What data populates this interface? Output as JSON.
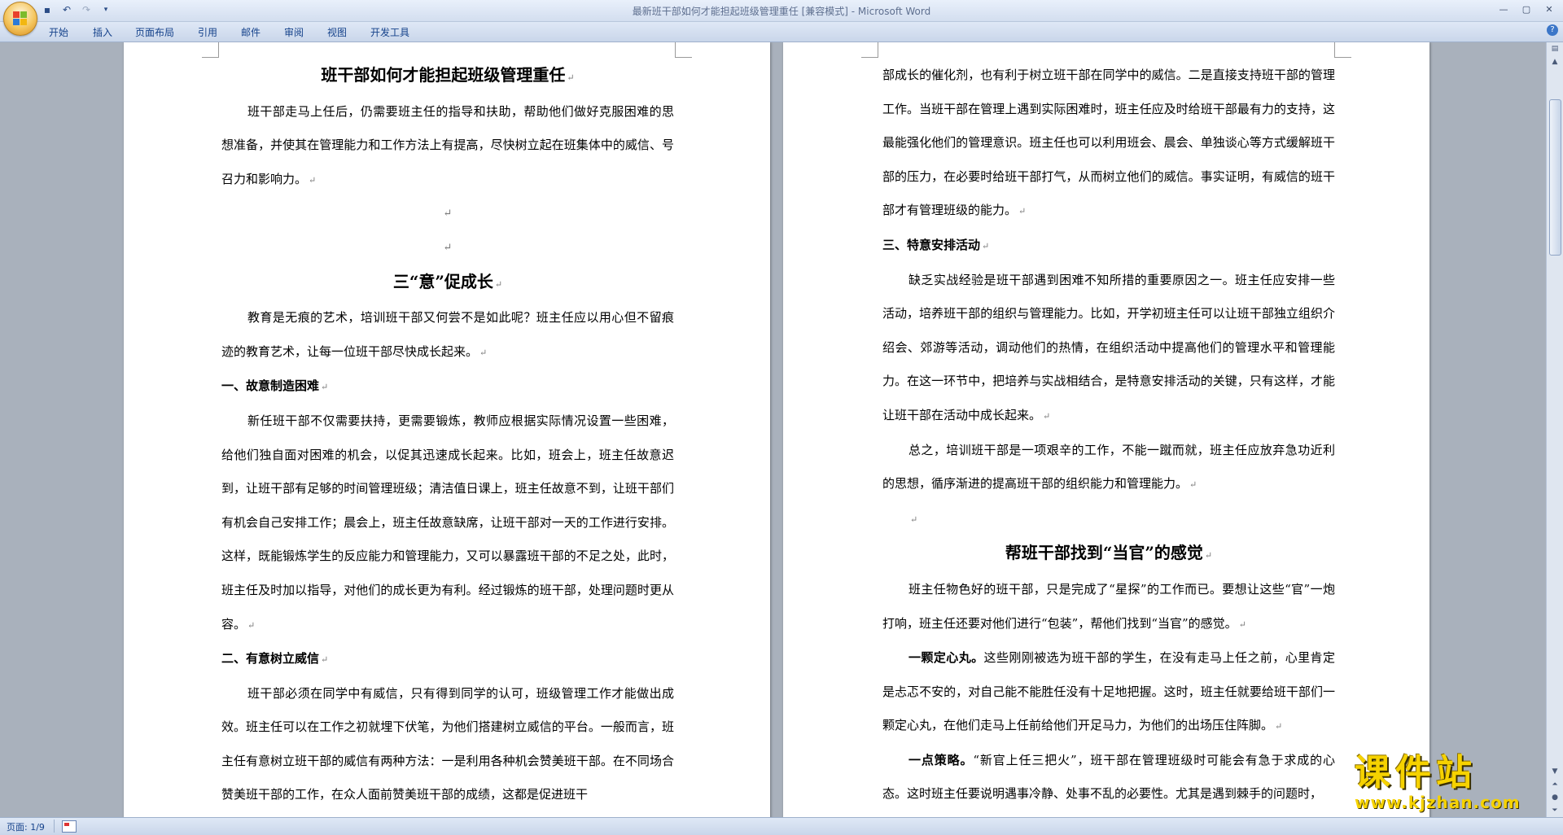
{
  "window": {
    "title": "最新班干部如何才能担起班级管理重任 [兼容模式] - Microsoft Word",
    "controls": [
      "minimize",
      "maximize",
      "close"
    ]
  },
  "quick_access": {
    "icons": [
      "save-icon",
      "undo-icon",
      "redo-icon",
      "customize-icon"
    ],
    "save_glyph": "▪",
    "undo_glyph": "↶",
    "redo_glyph": "↷",
    "customize_glyph": "▾"
  },
  "ribbon": {
    "tabs": [
      "开始",
      "插入",
      "页面布局",
      "引用",
      "邮件",
      "审阅",
      "视图",
      "开发工具"
    ]
  },
  "left_page": {
    "title": "班干部如何才能担起班级管理重任",
    "intro": "班干部走马上任后，仍需要班主任的指导和扶助，帮助他们做好克服困难的思想准备，并使其在管理能力和工作方法上有提高，尽快树立起在班集体中的威信、号召力和影响力。",
    "section_title": "三“意”促成长",
    "section_intro": "教育是无痕的艺术，培训班干部又何尝不是如此呢？班主任应以用心但不留痕迹的教育艺术，让每一位班干部尽快成长起来。",
    "heading1": "一、故意制造困难",
    "para1": "新任班干部不仅需要扶持，更需要锻炼，教师应根据实际情况设置一些困难，给他们独自面对困难的机会，以促其迅速成长起来。比如，班会上，班主任故意迟到，让班干部有足够的时间管理班级；清洁值日课上，班主任故意不到，让班干部们有机会自己安排工作；晨会上，班主任故意缺席，让班干部对一天的工作进行安排。这样，既能锻炼学生的反应能力和管理能力，又可以暴露班干部的不足之处，此时，班主任及时加以指导，对他们的成长更为有利。经过锻炼的班干部，处理问题时更从容。",
    "heading2": "二、有意树立威信",
    "para2": "班干部必须在同学中有威信，只有得到同学的认可，班级管理工作才能做出成效。班主任可以在工作之初就埋下伏笔，为他们搭建树立威信的平台。一般而言，班主任有意树立班干部的威信有两种方法：一是利用各种机会赞美班干部。在不同场合赞美班干部的工作，在众人面前赞美班干部的成绩，这都是促进班干"
  },
  "right_page": {
    "para_cont": "部成长的催化剂，也有利于树立班干部在同学中的威信。二是直接支持班干部的管理工作。当班干部在管理上遇到实际困难时，班主任应及时给班干部最有力的支持，这最能强化他们的管理意识。班主任也可以利用班会、晨会、单独谈心等方式缓解班干部的压力，在必要时给班干部打气，从而树立他们的威信。事实证明，有威信的班干部才有管理班级的能力。",
    "heading3": "三、特意安排活动",
    "para3": "缺乏实战经验是班干部遇到困难不知所措的重要原因之一。班主任应安排一些活动，培养班干部的组织与管理能力。比如，开学初班主任可以让班干部独立组织介绍会、郊游等活动，调动他们的热情，在组织活动中提高他们的管理水平和管理能力。在这一环节中，把培养与实战相结合，是特意安排活动的关键，只有这样，才能让班干部在活动中成长起来。",
    "para4": "总之，培训班干部是一项艰辛的工作，不能一蹴而就，班主任应放弃急功近利的思想，循序渐进的提高班干部的组织能力和管理能力。",
    "title2": "帮班干部找到“当官”的感觉",
    "para5": "班主任物色好的班干部，只是完成了“星探”的工作而已。要想让这些“官”一炮打响，班主任还要对他们进行“包装”，帮他们找到“当官”的感觉。",
    "lead6": "一颗定心丸。",
    "para6": "这些刚刚被选为班干部的学生，在没有走马上任之前，心里肯定是忐忑不安的，对自己能不能胜任没有十足地把握。这时，班主任就要给班干部们一颗定心丸，在他们走马上任前给他们开足马力，为他们的出场压住阵脚。",
    "lead7": "一点策略。",
    "para7": "“新官上任三把火”，班干部在管理班级时可能会有急于求成的心态。这时班主任要说明遇事冷静、处事不乱的必要性。尤其是遇到棘手的问题时，"
  },
  "marks": {
    "paragraph_mark": "↵"
  },
  "status": {
    "page_count": "页面: 1/9"
  },
  "watermark": {
    "text": "课件站",
    "url": "www.kjzhan.com"
  }
}
